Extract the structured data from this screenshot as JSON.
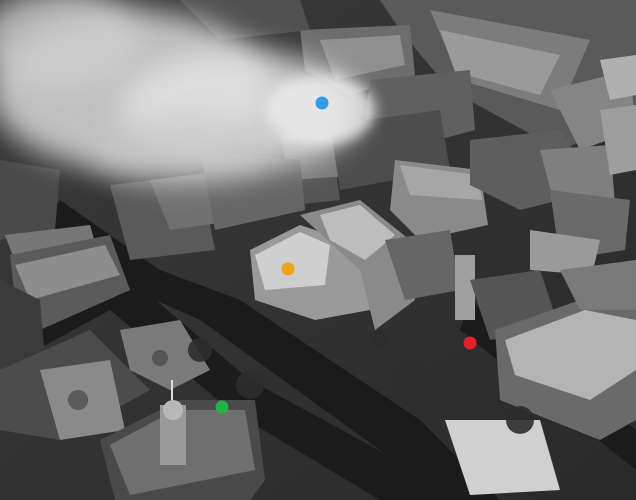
{
  "image": {
    "style": "black-and-white aerial photograph"
  },
  "markers": [
    {
      "id": "blue",
      "color": "#2f9ee8"
    },
    {
      "id": "orange",
      "color": "#f2a11d"
    },
    {
      "id": "red",
      "color": "#e3202b"
    },
    {
      "id": "green",
      "color": "#25b34b"
    }
  ]
}
